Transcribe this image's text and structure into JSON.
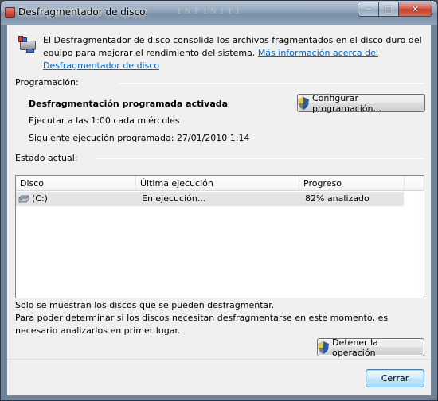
{
  "window": {
    "title": "Desfragmentador de disco",
    "watermark": "INFINITI",
    "icons": {
      "app": "defrag-icon",
      "minimize": "minimize-icon",
      "maximize": "maximize-icon",
      "close": "close-icon"
    }
  },
  "intro": {
    "text": "El Desfragmentador de disco consolida los archivos fragmentados en el disco duro del equipo para mejorar el rendimiento del sistema.",
    "link": "Más información acerca del Desfragmentador de disco",
    "trailing": "."
  },
  "schedule": {
    "section_label": "Programación:",
    "status": "Desfragmentación programada activada",
    "run_at": "Ejecutar a las 1:00 cada miércoles",
    "next_run": "Siguiente ejecución programada: 27/01/2010 1:14",
    "configure_button": "Configurar programación..."
  },
  "current": {
    "section_label": "Estado actual:",
    "columns": [
      "Disco",
      "Última ejecución",
      "Progreso"
    ],
    "rows": [
      {
        "disk": "(C:)",
        "last_run": "En ejecución...",
        "progress": "82% analizado"
      }
    ]
  },
  "notes": {
    "line1": "Solo se muestran los discos que se pueden desfragmentar.",
    "line2": "Para poder determinar si los discos necesitan desfragmentarse en este momento, es necesario analizarlos en primer lugar."
  },
  "buttons": {
    "stop": "Detener la operación",
    "close": "Cerrar"
  },
  "colors": {
    "link": "#0066cc",
    "selection_row": "#e4e4e4"
  }
}
